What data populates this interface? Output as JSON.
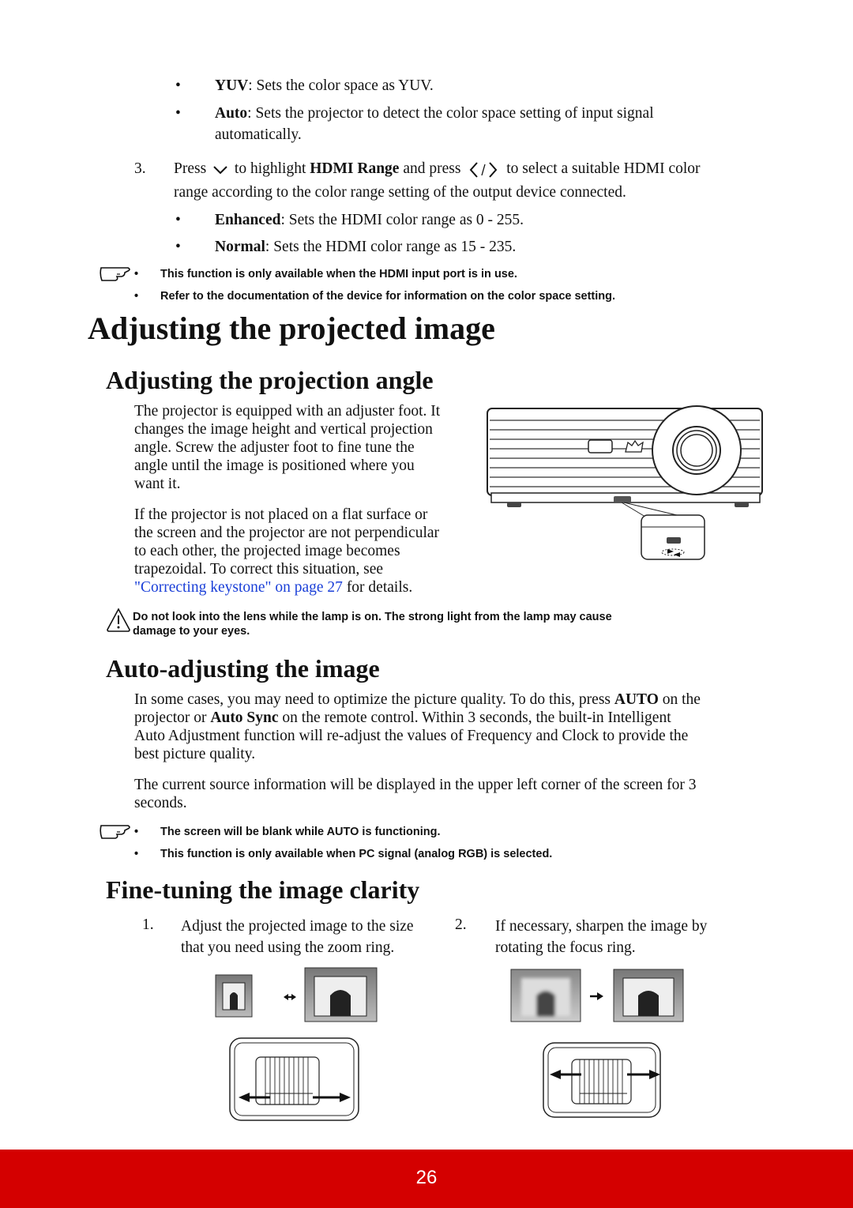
{
  "colorspace_bullets": [
    {
      "term": "YUV",
      "text": ": Sets the color space as YUV."
    },
    {
      "term": "Auto",
      "text": ": Sets the projector to detect the color space setting of input signal",
      "text2": "automatically."
    }
  ],
  "step3": {
    "number": "3.",
    "press": "Press",
    "down_icon": "chevron-down-icon",
    "mid1": "to highlight",
    "term": "HDMI Range",
    "mid2": "and press",
    "lr_icon": "chevron-left-right-icon",
    "end": "to select a suitable HDMI color",
    "line2": "range according to the color range setting of the output device connected."
  },
  "hdmi_bullets": [
    {
      "term": "Enhanced",
      "text": ": Sets the HDMI color range as 0 - 255."
    },
    {
      "term": "Normal",
      "text": ": Sets the HDMI color range as 15 - 235."
    }
  ],
  "note1": [
    "This function is only available when the HDMI input port is in use.",
    "Refer to the documentation of the device for information on the color space setting."
  ],
  "heading_main": "Adjusting the projected image",
  "heading_angle": "Adjusting the projection angle",
  "angle_para1": [
    "The projector is equipped with an adjuster foot. It",
    "changes the image height and vertical projection",
    "angle. Screw the adjuster foot to fine tune the",
    "angle until the image is positioned where you",
    "want it."
  ],
  "angle_para2": [
    "If the projector is not placed on a flat surface or",
    "the screen and the projector are not perpendicular",
    "to each other, the projected image becomes",
    "trapezoidal. To correct this situation, see"
  ],
  "angle_link": "\"Correcting keystone\" on page 27",
  "angle_link_tail": " for details.",
  "warning": [
    "Do not look into the lens while the lamp is on. The strong light from the lamp may cause",
    "damage to your eyes."
  ],
  "heading_auto": "Auto-adjusting the image",
  "auto_para1": {
    "l1a": "In some cases, you may need to optimize the picture quality. To do this, press ",
    "l1b": "AUTO",
    "l1c": " on the",
    "l2a": "projector or ",
    "l2b": "Auto Sync",
    "l2c": " on the remote control. Within 3 seconds, the built-in Intelligent",
    "l3": "Auto Adjustment function will re-adjust the values of Frequency and Clock to provide the",
    "l4": "best picture quality."
  },
  "auto_para2": [
    "The current source information will be displayed in the upper left corner of the screen for 3",
    "seconds."
  ],
  "note2": [
    "The screen will be blank while AUTO is functioning.",
    "This function is only available when PC signal (analog RGB) is selected."
  ],
  "heading_fine": "Fine-tuning the image clarity",
  "fine_steps": [
    {
      "num": "1.",
      "l1": "Adjust the projected image to the size",
      "l2": "that you need using the zoom ring."
    },
    {
      "num": "2.",
      "l1": "If necessary, sharpen the image by",
      "l2": "rotating the focus ring."
    }
  ],
  "bullet_char": "•",
  "page_number": "26",
  "colors": {
    "footer": "#d40000",
    "link": "#1a3fd8"
  }
}
